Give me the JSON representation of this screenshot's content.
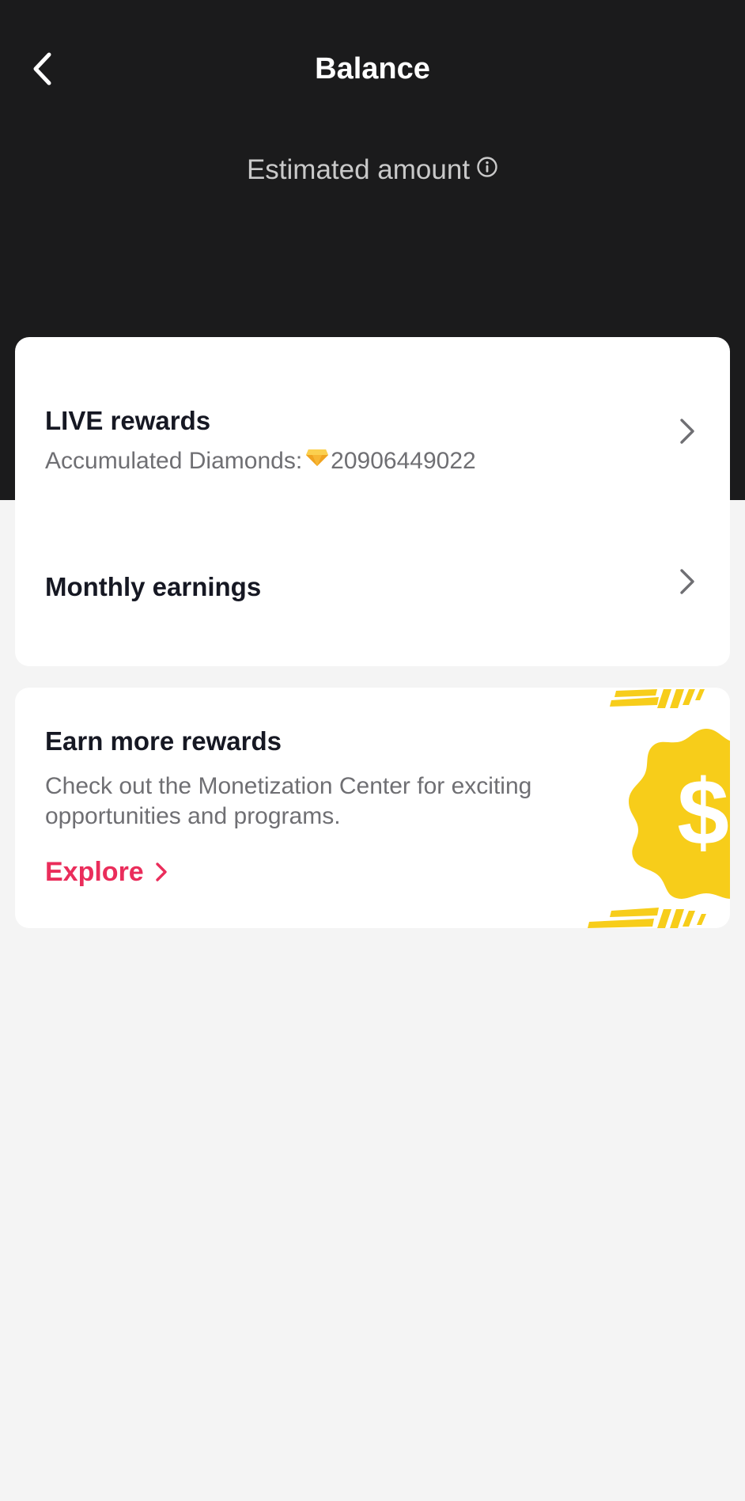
{
  "header": {
    "title": "Balance",
    "back_icon": "chevron-left-icon"
  },
  "estimate": {
    "label": "Estimated amount",
    "icon": "info-icon"
  },
  "rewards_card": {
    "live": {
      "title": "LIVE rewards",
      "diamonds_label": "Accumulated Diamonds:",
      "diamonds_icon": "diamond-icon",
      "diamonds_value": "20906449022"
    },
    "monthly": {
      "title": "Monthly earnings"
    }
  },
  "earn_card": {
    "title": "Earn more rewards",
    "description": "Check out the Monetization Center for exciting opportunities and programs.",
    "link_label": "Explore",
    "art_icon": "dollar-coin-icon"
  },
  "colors": {
    "header_bg": "#1b1b1c",
    "page_bg": "#f4f4f4",
    "accent": "#ea2d5b",
    "coin_yellow": "#f7cd1a"
  }
}
